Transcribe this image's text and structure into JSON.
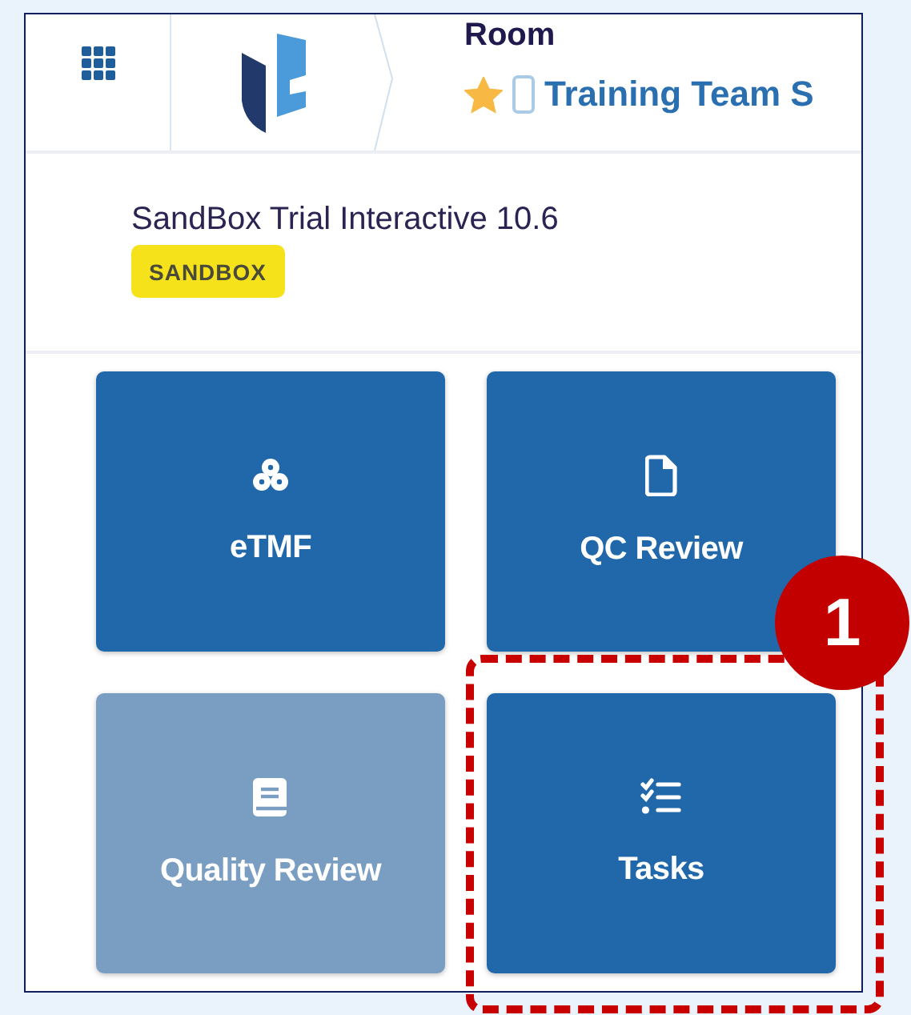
{
  "header": {
    "room_label": "Room",
    "favorite": true,
    "room_name": "Training Team S"
  },
  "study": {
    "title": "SandBox Trial Interactive 10.6",
    "badge": "SANDBOX"
  },
  "tiles": [
    {
      "label": "eTMF",
      "kind": "cubes",
      "disabled": false,
      "highlighted": false
    },
    {
      "label": "QC Review",
      "kind": "file",
      "disabled": false,
      "highlighted": false
    },
    {
      "label": "Quality Review",
      "kind": "book",
      "disabled": true,
      "highlighted": false
    },
    {
      "label": "Tasks",
      "kind": "tasks",
      "disabled": false,
      "highlighted": true
    }
  ],
  "callout": {
    "number": "1"
  }
}
